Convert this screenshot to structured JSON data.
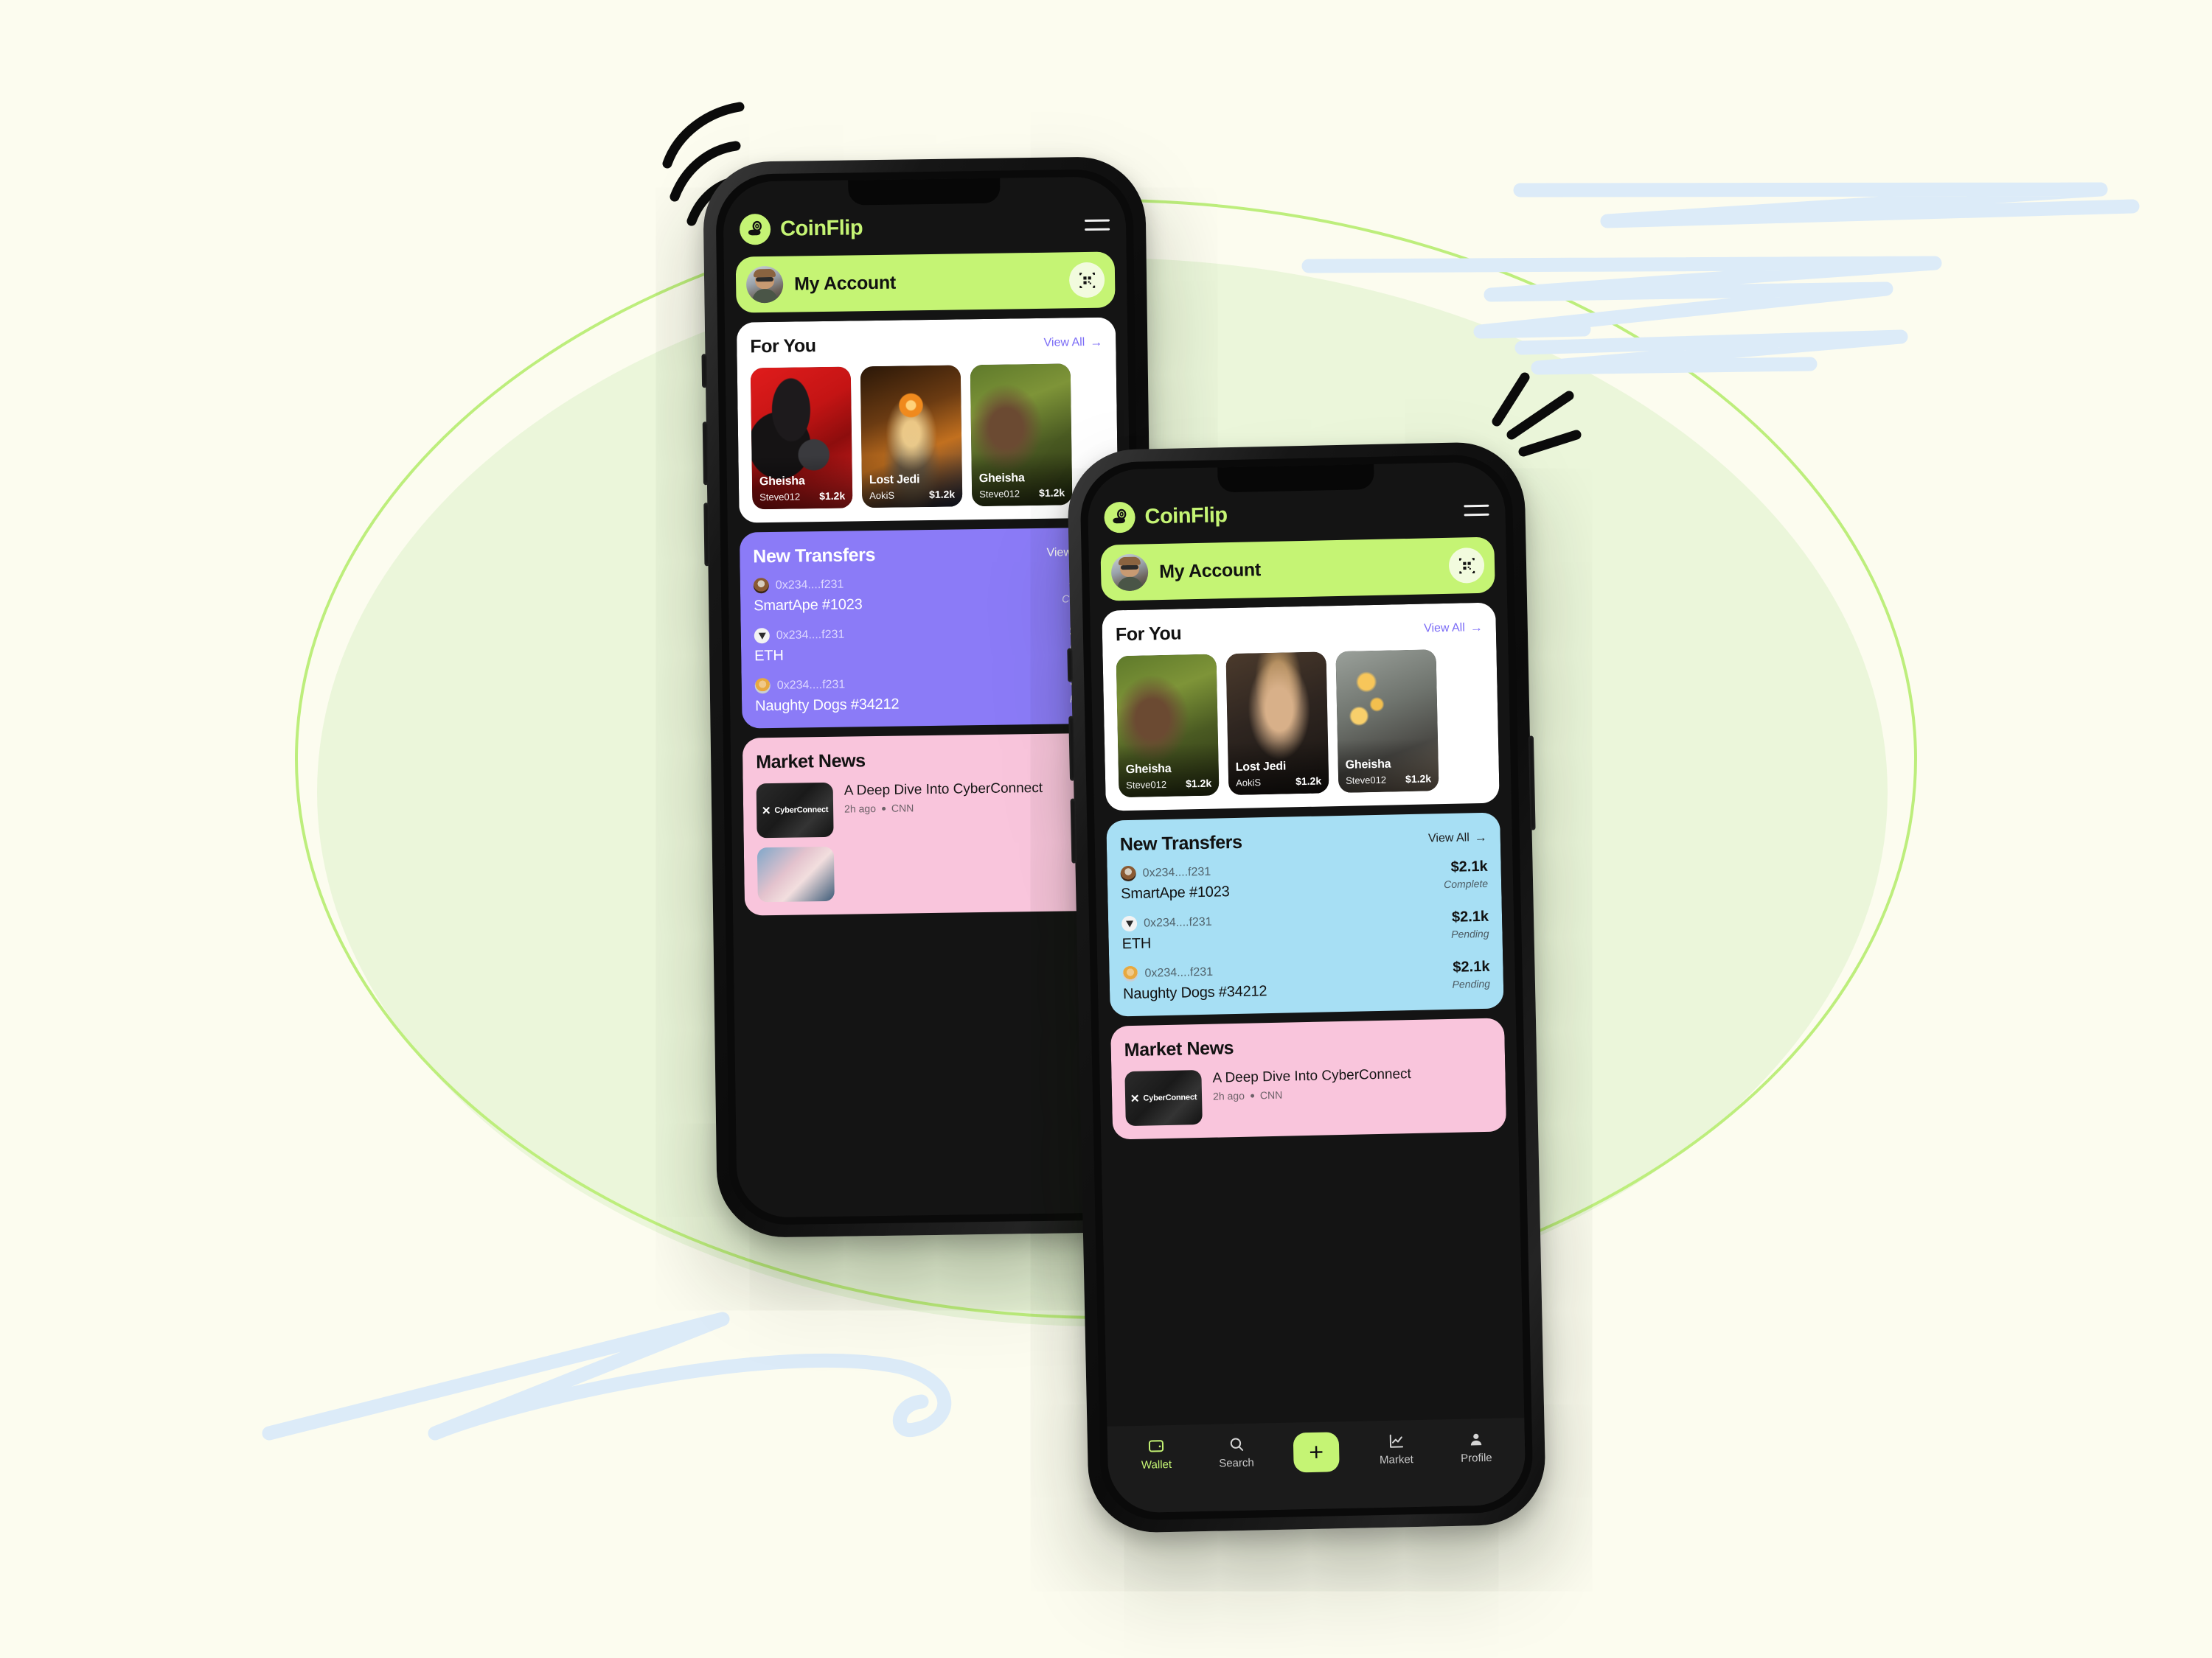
{
  "theme": {
    "background": "#FCFCEF",
    "accent_green": "#C5F474",
    "blob_green": "#EBF6DA",
    "ring_green": "#BDEE7C",
    "purple_card": "#8B7BF7",
    "blue_card": "#A7DFF4",
    "pink_card": "#F9C5DC",
    "link_purple": "#7B6CF6",
    "phone_body": "#0F0F0F",
    "screen_dark": "#141414",
    "deco_blue": "#DCEBF8"
  },
  "app": {
    "brand": "CoinFlip",
    "logo_icon": "coin-flip-icon",
    "menu_icon": "hamburger-menu-icon",
    "account": {
      "label": "My Account",
      "avatar_icon": "user-avatar",
      "qr_icon": "qr-code-icon"
    },
    "for_you": {
      "title": "For You",
      "view_all": "View All",
      "arrow_icon": "arrow-right-icon",
      "items_front": [
        {
          "name": "Gheisha",
          "owner": "Steve012",
          "price": "$1.2k",
          "art": "art-tribal"
        },
        {
          "name": "Lost Jedi",
          "owner": "AokiS",
          "price": "$1.2k",
          "art": "art-portrait"
        },
        {
          "name": "Gheisha",
          "owner": "Steve012",
          "price": "$1.2k",
          "art": "art-lantern"
        }
      ],
      "items_back": [
        {
          "name": "Gheisha",
          "owner": "Steve012",
          "price": "$1.2k",
          "art": "art-gheisha"
        },
        {
          "name": "Lost Jedi",
          "owner": "AokiS",
          "price": "$1.2k",
          "art": "art-jedi"
        },
        {
          "name": "Gheisha",
          "owner": "Steve012",
          "price": "$1.2k",
          "art": "art-tribal"
        }
      ]
    },
    "new_transfers": {
      "title": "New Transfers",
      "view_all": "View All",
      "arrow_icon": "arrow-right-icon",
      "rows": [
        {
          "address": "0x234....f231",
          "name": "SmartApe #1023",
          "amount": "$2.1k",
          "status": "Complete",
          "avatar": "ava-ape"
        },
        {
          "address": "0x234....f231",
          "name": "ETH",
          "amount": "$2.1k",
          "status": "Pending",
          "avatar": "ava-eth"
        },
        {
          "address": "0x234....f231",
          "name": "Naughty Dogs #34212",
          "amount": "$2.1k",
          "status": "Pending",
          "avatar": "ava-dog"
        }
      ]
    },
    "market_news": {
      "title": "Market News",
      "items": [
        {
          "thumb_mark": "✕",
          "thumb_label": "CyberConnect",
          "title": "A Deep Dive Into CyberConnect",
          "time": "2h ago",
          "source": "CNN"
        }
      ]
    },
    "tabbar": [
      {
        "label": "Wallet",
        "icon": "wallet-icon",
        "active": true
      },
      {
        "label": "Search",
        "icon": "search-icon",
        "active": false
      },
      {
        "label": "",
        "icon": "plus-icon",
        "active": false
      },
      {
        "label": "Market",
        "icon": "chart-line-icon",
        "active": false
      },
      {
        "label": "Profile",
        "icon": "person-icon",
        "active": false
      }
    ]
  }
}
